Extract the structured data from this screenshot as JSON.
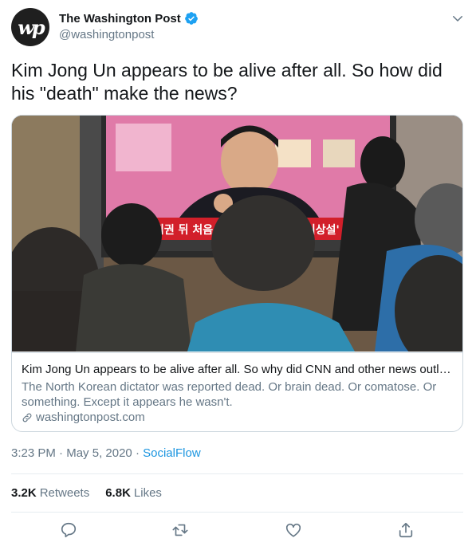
{
  "author": {
    "display_name": "The Washington Post",
    "handle": "@washingtonpost",
    "avatar_logo_text": "wp"
  },
  "tweet": {
    "text": "Kim Jong Un appears to be alive after all. So how did his \"death\" make the news?"
  },
  "card": {
    "image_overlay_left": "집권 뒤 처음 터",
    "image_overlay_right": "강이상설' 제기",
    "title": "Kim Jong Un appears to be alive after all. So why did CNN and other news outlet…",
    "description": "The North Korean dictator was reported dead. Or brain dead. Or comatose. Or something. Except it appears he wasn't.",
    "domain": "washingtonpost.com"
  },
  "meta": {
    "time": "3:23 PM",
    "date": "May 5, 2020",
    "separator": " · ",
    "source": "SocialFlow"
  },
  "stats": {
    "retweets_count": "3.2K",
    "retweets_label": "Retweets",
    "likes_count": "6.8K",
    "likes_label": "Likes"
  },
  "colors": {
    "verified": "#1da1f2",
    "link": "#1b95e0",
    "secondary_text": "#657786"
  },
  "icons": [
    "verified-badge-icon",
    "chevron-down-icon",
    "link-icon",
    "reply-icon",
    "retweet-icon",
    "like-icon",
    "share-icon"
  ]
}
